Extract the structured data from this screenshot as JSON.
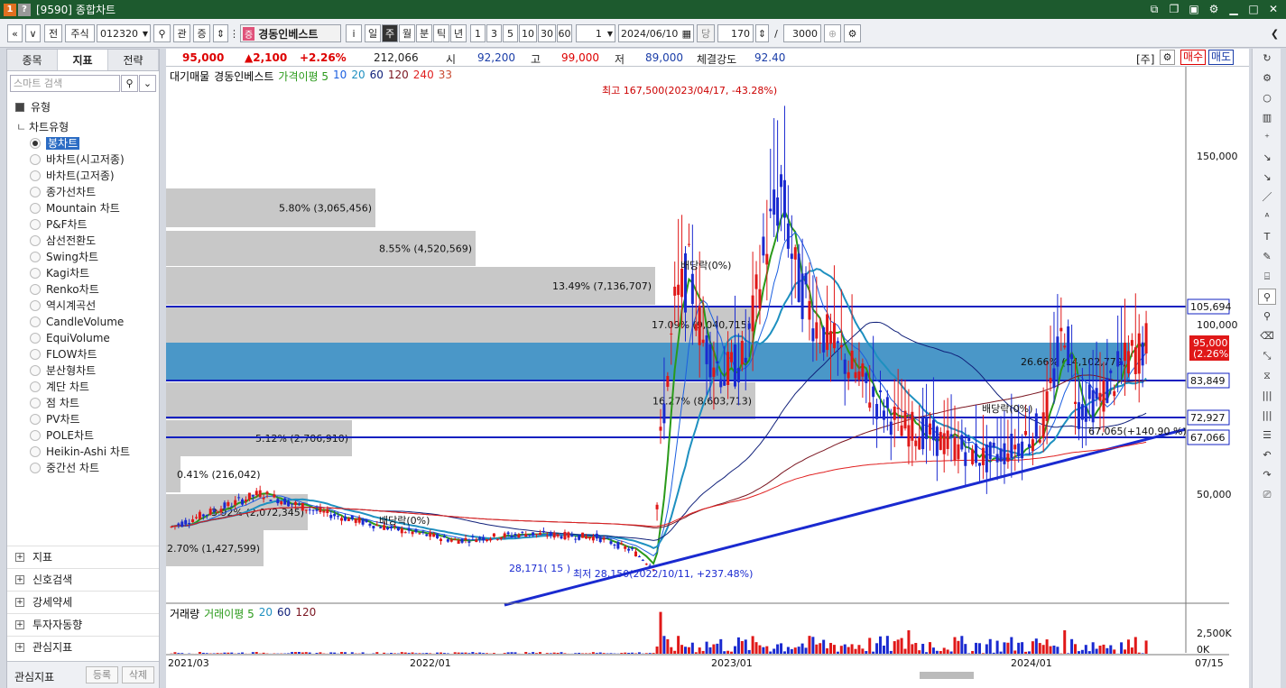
{
  "window": {
    "code": "[9590]",
    "title": "종합차트",
    "badge1": "1",
    "badge2": "?"
  },
  "toolbar": {
    "nav_prev": "«",
    "nav_down": "≫",
    "btn_jeon": "전",
    "market": "주식",
    "stock_code": "012320",
    "btn_gwan": "관",
    "btn_jeung": "증",
    "stock_tag": "증",
    "stock_name": "경동인베스트",
    "btn_info": "i",
    "periods": [
      "일",
      "주",
      "월",
      "분",
      "틱",
      "년"
    ],
    "selected_period": "주",
    "intervals": [
      "1",
      "3",
      "5",
      "10",
      "30",
      "60"
    ],
    "unit_value": "1",
    "date": "2024/06/10",
    "count_label": "당",
    "count": "170",
    "total": "3000"
  },
  "left_panel": {
    "tabs": [
      "종목",
      "지표",
      "전략"
    ],
    "active_tab": "지표",
    "search_placeholder": "스마트 검색",
    "section_type": "유형",
    "subsection": "차트유형",
    "chart_types": [
      "봉차트",
      "바차트(시고저종)",
      "바차트(고저종)",
      "종가선차트",
      "Mountain 차트",
      "P&F차트",
      "삼선전환도",
      "Swing차트",
      "Kagi차트",
      "Renko차트",
      "역시계곡선",
      "CandleVolume",
      "EquiVolume",
      "FLOW차트",
      "분산형차트",
      "계단 차트",
      "점 차트",
      "PV차트",
      "POLE차트",
      "Heikin-Ashi 차트",
      "중간선 차트"
    ],
    "selected_type": "봉차트",
    "footer_sections": [
      "지표",
      "신호검색",
      "강세약세",
      "투자자동향",
      "관심지표"
    ],
    "bottom_label": "관심지표",
    "btn_register": "등록",
    "btn_delete": "삭제"
  },
  "price_bar": {
    "price": "95,000",
    "change": "▲2,100",
    "change_pct": "+2.26%",
    "volume": "212,066",
    "open_label": "시",
    "open": "92,200",
    "high_label": "고",
    "high": "99,000",
    "low_label": "저",
    "low": "89,000",
    "strength_label": "체결강도",
    "strength": "92.40",
    "btn_stock": "[주]",
    "btn_buy": "매수",
    "btn_sell": "매도"
  },
  "legend": {
    "items": [
      {
        "text": "대기매물",
        "color": "#000000"
      },
      {
        "text": "경동인베스트",
        "color": "#000000"
      },
      {
        "text": "가격이평 5",
        "color": "#2a9a1a"
      },
      {
        "text": "10",
        "color": "#1b5fe0"
      },
      {
        "text": "20",
        "color": "#1e90c0"
      },
      {
        "text": "60",
        "color": "#10207a"
      },
      {
        "text": "120",
        "color": "#7a1520"
      },
      {
        "text": "240",
        "color": "#e02020"
      },
      {
        "text": "33",
        "color": "#c84b31"
      }
    ]
  },
  "volume_legend": {
    "items": [
      {
        "text": "거래량",
        "color": "#000000"
      },
      {
        "text": "거래이평 5",
        "color": "#2a9a1a"
      },
      {
        "text": "20",
        "color": "#1e90c0"
      },
      {
        "text": "60",
        "color": "#10207a"
      },
      {
        "text": "120",
        "color": "#7a1520"
      }
    ]
  },
  "chart_data": {
    "type": "candlestick",
    "y_axis_ticks": [
      "150,000",
      "100,000",
      "50,000"
    ],
    "volume_ticks": [
      "2,500K",
      "0K"
    ],
    "x_axis_ticks": [
      "2021/03",
      "2022/01",
      "2023/01",
      "2024/01",
      "07/15"
    ],
    "price_levels": [
      {
        "label": "105,694",
        "value": 105694
      },
      {
        "label": "83,849",
        "value": 83849
      },
      {
        "label": "72,927",
        "value": 72927
      },
      {
        "label": "67,066",
        "value": 67066
      }
    ],
    "current_price_label": "95,000",
    "current_change_label": "(2.26%)",
    "volume_profile": [
      "5.80% (3,065,456)",
      "8.55% (4,520,569)",
      "13.49% (7,136,707)",
      "17.09% (9,040,715)",
      "26.66% (14,102,779)",
      "16.27% (8,603,713)",
      "5.12% (2,706,910)",
      "0.41% (216,042)",
      "3.92% (2,072,345)",
      "2.70% (1,427,599)"
    ],
    "annotations": [
      "최고 167,500(2023/04/17, -43.28%)",
      "최저 28,150(2022/10/11, +237.48%)",
      "28,171( 15 )",
      "배당락(0%)",
      "배당락(0%)",
      "배당락(0%)",
      "67,065(+140.90 %)"
    ]
  }
}
